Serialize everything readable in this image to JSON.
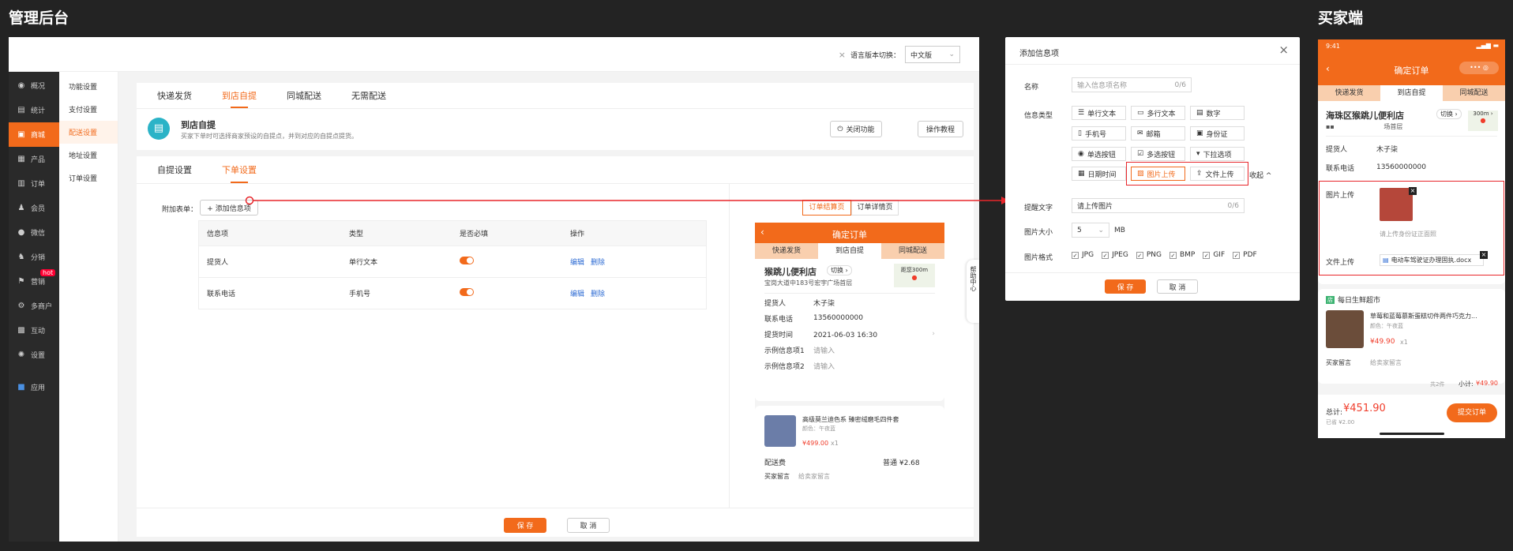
{
  "sections": {
    "admin": "管理后台",
    "buyer": "买家端"
  },
  "admin": {
    "topbar": {
      "lang_label": "语言版本切换：",
      "lang_value": "中文版"
    },
    "sidebar": [
      {
        "label": "概况",
        "icon": "dashboard-icon"
      },
      {
        "label": "统计",
        "icon": "chart-icon"
      },
      {
        "label": "商城",
        "icon": "store-icon",
        "active": true
      },
      {
        "label": "产品",
        "icon": "product-icon"
      },
      {
        "label": "订单",
        "icon": "order-icon"
      },
      {
        "label": "会员",
        "icon": "member-icon"
      },
      {
        "label": "微信",
        "icon": "wechat-icon"
      },
      {
        "label": "分销",
        "icon": "distribution-icon"
      },
      {
        "label": "营销",
        "icon": "marketing-icon",
        "badge": "hot"
      },
      {
        "label": "多商户",
        "icon": "merchant-icon"
      },
      {
        "label": "互动",
        "icon": "interact-icon"
      },
      {
        "label": "设置",
        "icon": "gear-icon"
      },
      {
        "label": "应用",
        "icon": "apps-icon"
      }
    ],
    "submenu": [
      "功能设置",
      "支付设置",
      "配送设置",
      "地址设置",
      "订单设置"
    ],
    "tabs": [
      "快递发货",
      "到店自提",
      "同城配送",
      "无需配送"
    ],
    "pickup": {
      "title": "到店自提",
      "desc": "买家下单时可选择商家预设的自提点，并到对应的自提点提货。",
      "close_btn": "关闭功能",
      "tutorial_btn": "操作教程"
    },
    "subtabs": [
      "自提设置",
      "下单设置"
    ],
    "form": {
      "label": "附加表单：",
      "add_btn": "+ 添加信息项",
      "page_tabs": [
        "订单结算页",
        "订单详情页"
      ],
      "headers": [
        "信息项",
        "类型",
        "是否必填",
        "操作"
      ],
      "rows": [
        {
          "name": "提货人",
          "type": "单行文本",
          "edit": "编辑",
          "del": "删除"
        },
        {
          "name": "联系电话",
          "type": "手机号",
          "edit": "编辑",
          "del": "删除"
        }
      ]
    },
    "footer": {
      "save": "保 存",
      "cancel": "取 消"
    },
    "help": "帮助中心",
    "preview": {
      "header": "确定订单",
      "tabs": [
        "快递发货",
        "到店自提",
        "同城配送"
      ],
      "store": "猴跳儿便利店",
      "switch": "切换",
      "address": "宝岗大道中183号宏宇广场首层",
      "distance": "距您300m",
      "fields": [
        {
          "k": "提货人",
          "v": "木子柒"
        },
        {
          "k": "联系电话",
          "v": "13560000000"
        },
        {
          "k": "提货时间",
          "v": "2021-06-03 16:30"
        },
        {
          "k": "示例信息项1",
          "v": "请输入"
        },
        {
          "k": "示例信息项2",
          "v": "请输入"
        }
      ],
      "product": {
        "name": "高级莫兰迪色系 臻密绒磨毛四件套",
        "spec": "颜色：午夜蓝",
        "price": "¥499.00",
        "qty": "x1"
      },
      "shipping_label": "配送费",
      "shipping_value": "普通 ¥2.68",
      "note_label": "买家留言",
      "note_ph": "给卖家留言"
    }
  },
  "modal": {
    "title": "添加信息项",
    "name_label": "名称",
    "name_ph": "输入信息项名称",
    "name_count": "0/6",
    "type_label": "信息类型",
    "types": [
      "单行文本",
      "多行文本",
      "数字",
      "手机号",
      "邮箱",
      "身份证",
      "单选按钮",
      "多选按钮",
      "下拉选项",
      "日期时间",
      "图片上传",
      "文件上传"
    ],
    "collapse": "收起",
    "hint_label": "提醒文字",
    "hint_value": "请上传图片",
    "hint_count": "0/6",
    "size_label": "图片大小",
    "size_value": "5",
    "size_unit": "MB",
    "format_label": "图片格式",
    "formats": [
      "JPG",
      "JPEG",
      "PNG",
      "BMP",
      "GIF",
      "PDF"
    ],
    "save": "保 存",
    "cancel": "取 消"
  },
  "buyer": {
    "time": "9:41",
    "header": "确定订单",
    "tabs": [
      "快递发货",
      "到店自提",
      "同城配送"
    ],
    "store": "海珠区猴跳儿便利店",
    "switch": "切换",
    "address_tail": "场首层",
    "distance": "300m",
    "fields": [
      {
        "k": "提货人",
        "v": "木子柒"
      },
      {
        "k": "联系电话",
        "v": "13560000000"
      }
    ],
    "image_label": "图片上传",
    "image_hint": "请上传身份证正面照",
    "file_label": "文件上传",
    "file_name": "电动车驾驶证办理固执.docx",
    "shop": "每日生鲜超市",
    "product": {
      "name": "草莓和蓝莓慕斯蛋糕切件两件巧克力...",
      "spec": "颜色：午夜蓝",
      "price": "¥49.90",
      "qty": "x1"
    },
    "note_label": "买家留言",
    "note_ph": "给卖家留言",
    "count": "共2件",
    "subtotal_label": "小计:",
    "subtotal": "¥49.90",
    "total_label": "总计:",
    "total": "¥451.90",
    "saved": "已省 ¥2.00",
    "submit": "提交订单"
  },
  "colors": {
    "accent": "#f26a1b",
    "link": "#2d6bd3",
    "highlight": "#e8262b"
  }
}
